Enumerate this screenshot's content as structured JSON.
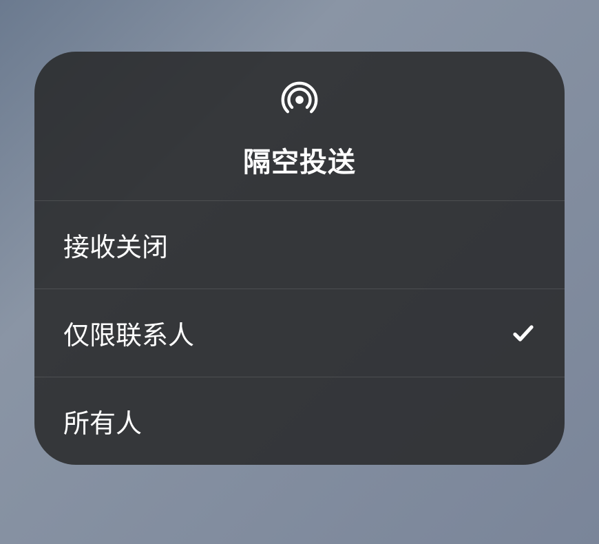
{
  "panel": {
    "title": "隔空投送",
    "icon_name": "airdrop-icon"
  },
  "options": [
    {
      "label": "接收关闭",
      "selected": false
    },
    {
      "label": "仅限联系人",
      "selected": true
    },
    {
      "label": "所有人",
      "selected": false
    }
  ]
}
